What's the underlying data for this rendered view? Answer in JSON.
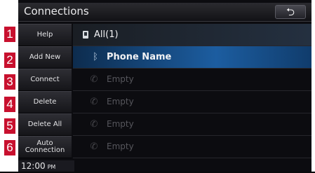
{
  "header": {
    "title": "Connections",
    "back_icon": "back-arrow-icon"
  },
  "menu": {
    "items": [
      {
        "badge": "1",
        "label": "Help"
      },
      {
        "badge": "2",
        "label": "Add New"
      },
      {
        "badge": "3",
        "label": "Connect"
      },
      {
        "badge": "4",
        "label": "Delete"
      },
      {
        "badge": "5",
        "label": "Delete All"
      },
      {
        "badge": "6",
        "label": "Auto\nConnection"
      }
    ]
  },
  "list": {
    "all_label": "All(1)",
    "rows": [
      {
        "label": "Phone Name",
        "icon": "bluetooth-icon",
        "selected": true
      },
      {
        "label": "Empty",
        "icon": "phone-handset-icon"
      },
      {
        "label": "Empty",
        "icon": "phone-handset-icon"
      },
      {
        "label": "Empty",
        "icon": "phone-handset-icon"
      },
      {
        "label": "Empty",
        "icon": "phone-handset-icon"
      }
    ]
  },
  "footer": {
    "time": "12:00",
    "ampm": "PM"
  },
  "colors": {
    "badge": "#c8102e",
    "selected_row": "#1c5da0"
  }
}
